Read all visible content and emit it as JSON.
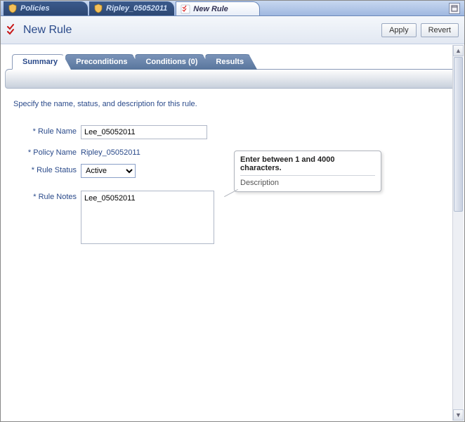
{
  "doc_tabs": {
    "policies": "Policies",
    "ripley": "Ripley_05052011",
    "new_rule": "New Rule"
  },
  "header": {
    "title": "New Rule",
    "apply": "Apply",
    "revert": "Revert"
  },
  "sub_tabs": {
    "summary": "Summary",
    "preconditions": "Preconditions",
    "conditions": "Conditions (0)",
    "results": "Results"
  },
  "instructions": "Specify the name, status, and description for this rule.",
  "form": {
    "rule_name_label": "Rule Name",
    "rule_name_value": "Lee_05052011",
    "policy_name_label": "Policy Name",
    "policy_name_value": "Ripley_05052011",
    "rule_status_label": "Rule Status",
    "rule_status_value": "Active",
    "rule_notes_label": "Rule Notes",
    "rule_notes_value": "Lee_05052011",
    "required_marker": "*"
  },
  "tooltip": {
    "title": "Enter between 1 and 4000 characters.",
    "body": "Description"
  }
}
